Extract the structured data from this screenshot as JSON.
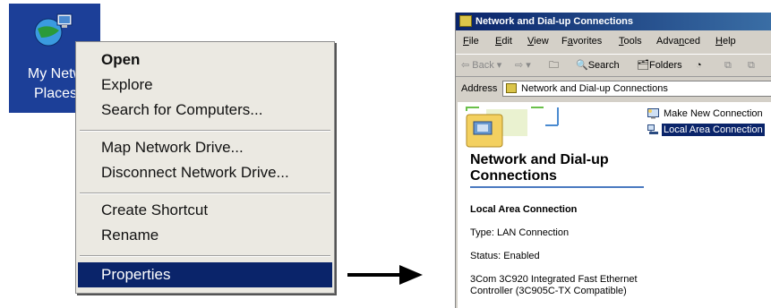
{
  "desktop": {
    "icon_label": "My Netw\nPlaces",
    "icon_name": "network-places-icon"
  },
  "context_menu": {
    "items": [
      {
        "label": "Open",
        "bold": true
      },
      {
        "label": "Explore"
      },
      {
        "label": "Search for Computers..."
      },
      {
        "label": "Map Network Drive..."
      },
      {
        "label": "Disconnect Network Drive..."
      },
      {
        "label": "Create Shortcut"
      },
      {
        "label": "Rename"
      },
      {
        "label": "Properties",
        "selected": true
      }
    ],
    "selected_color": "#0a246a"
  },
  "window": {
    "title": "Network and Dial-up Connections",
    "menu": [
      {
        "label": "File",
        "accel": "F"
      },
      {
        "label": "Edit",
        "accel": "E"
      },
      {
        "label": "View",
        "accel": "V"
      },
      {
        "label": "Favorites",
        "accel": "a"
      },
      {
        "label": "Tools",
        "accel": "T"
      },
      {
        "label": "Advanced",
        "accel": "n"
      },
      {
        "label": "Help",
        "accel": "H"
      }
    ],
    "toolbar": {
      "back": "Back",
      "search": "Search",
      "folders": "Folders"
    },
    "address": {
      "label": "Address",
      "value": "Network and Dial-up Connections"
    },
    "content": {
      "heading": "Network and Dial-up Connections",
      "detail_title": "Local Area Connection",
      "detail_type": "Type: LAN Connection",
      "detail_status": "Status: Enabled",
      "detail_desc": "3Com 3C920 Integrated Fast Ethernet Controller (3C905C-TX Compatible)"
    },
    "items": [
      {
        "label": "Make New Connection",
        "icon": "new-connection-icon"
      },
      {
        "label": "Local Area Connection",
        "icon": "lan-connection-icon",
        "selected": true
      }
    ]
  }
}
